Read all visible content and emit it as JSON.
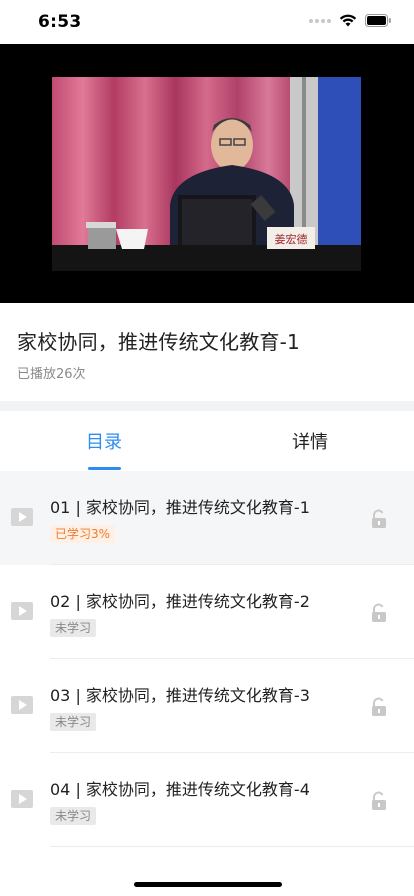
{
  "status_bar": {
    "time": "6:53"
  },
  "video": {},
  "title_block": {
    "title": "家校协同，推进传统文化教育-1",
    "play_count": "已播放26次"
  },
  "tabs": [
    {
      "label": "目录",
      "active": true
    },
    {
      "label": "详情",
      "active": false
    }
  ],
  "lessons": [
    {
      "title": "01 | 家校协同，推进传统文化教育-1",
      "status": "已学习3%"
    },
    {
      "title": "02 | 家校协同，推进传统文化教育-2",
      "status": "未学习"
    },
    {
      "title": "03 | 家校协同，推进传统文化教育-3",
      "status": "未学习"
    },
    {
      "title": "04 | 家校协同，推进传统文化教育-4",
      "status": "未学习"
    }
  ],
  "colors": {
    "accent": "#2d8cf0",
    "progress_badge": "#f27a2c"
  },
  "icons": [
    "signal-icon",
    "wifi-icon",
    "battery-icon",
    "play-icon",
    "lock-icon"
  ]
}
